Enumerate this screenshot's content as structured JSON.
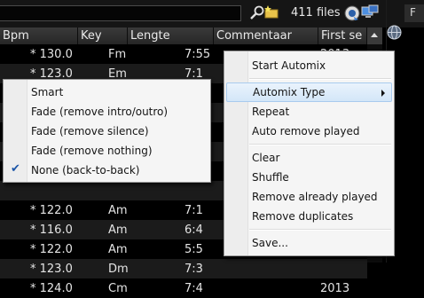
{
  "toolbar": {
    "file_count": "411 files",
    "tab_label": "F"
  },
  "columns": {
    "bpm": "Bpm",
    "key": "Key",
    "length": "Lengte",
    "comment": "Commentaar",
    "first_seen": "First se"
  },
  "rows": [
    {
      "mark": "*",
      "bpm": "130.0",
      "key": "Fm",
      "length": "7:55",
      "comment": "2013"
    },
    {
      "mark": "*",
      "bpm": "123.0",
      "key": "Em",
      "length": "7:1",
      "comment": ""
    },
    {
      "mark": "",
      "bpm": "",
      "key": "",
      "length": "",
      "comment": ""
    },
    {
      "mark": "",
      "bpm": "",
      "key": "",
      "length": "",
      "comment": ""
    },
    {
      "mark": "",
      "bpm": "",
      "key": "",
      "length": "",
      "comment": ""
    },
    {
      "mark": "",
      "bpm": "",
      "key": "",
      "length": "",
      "comment": ""
    },
    {
      "mark": "",
      "bpm": "",
      "key": "",
      "length": "",
      "comment": ""
    },
    {
      "mark": "",
      "bpm": "",
      "key": "",
      "length": "",
      "comment": ""
    },
    {
      "mark": "*",
      "bpm": "122.0",
      "key": "Am",
      "length": "7:1",
      "comment": ""
    },
    {
      "mark": "*",
      "bpm": "116.0",
      "key": "Am",
      "length": "6:4",
      "comment": ""
    },
    {
      "mark": "*",
      "bpm": "122.0",
      "key": "Am",
      "length": "5:5",
      "comment": ""
    },
    {
      "mark": "*",
      "bpm": "123.0",
      "key": "Dm",
      "length": "7:3",
      "comment": ""
    },
    {
      "mark": "*",
      "bpm": "124.0",
      "key": "Cm",
      "length": "7:4",
      "comment": "2013"
    }
  ],
  "context_menu": {
    "items": [
      {
        "label": "Start Automix"
      },
      {
        "label": "Automix Type"
      },
      {
        "label": "Repeat"
      },
      {
        "label": "Auto remove played"
      },
      {
        "label": "Clear"
      },
      {
        "label": "Shuffle"
      },
      {
        "label": "Remove already played"
      },
      {
        "label": "Remove duplicates"
      },
      {
        "label": "Save..."
      }
    ]
  },
  "automix_submenu": {
    "items": [
      {
        "label": "Smart"
      },
      {
        "label": "Fade (remove intro/outro)"
      },
      {
        "label": "Fade (remove silence)"
      },
      {
        "label": "Fade (remove nothing)"
      },
      {
        "label": "None (back-to-back)",
        "checked": true
      }
    ],
    "check_glyph": "✔"
  },
  "colors": {
    "highlight": "#d3e6f8",
    "menu_bg": "#f5f5f5",
    "check": "#1c56a8"
  }
}
